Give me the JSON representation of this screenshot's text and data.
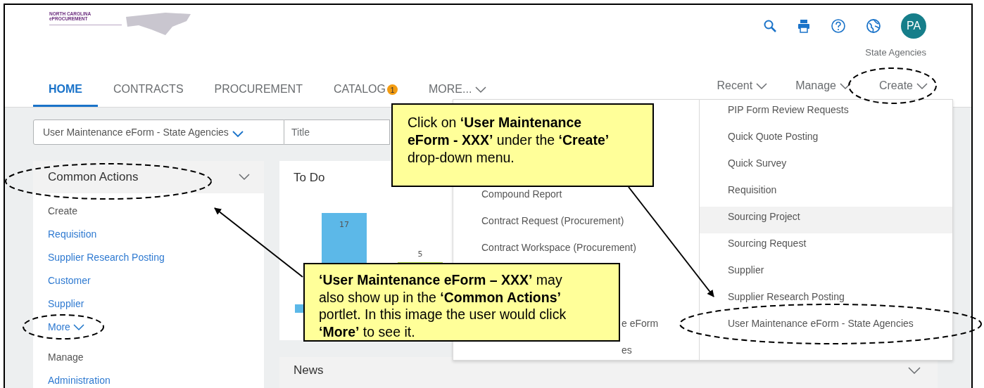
{
  "logo": {
    "lines": [
      "NORTH CAROLINA",
      "ePROCUREMENT"
    ]
  },
  "header": {
    "avatar": "PA",
    "organization": "State Agencies"
  },
  "tabs": [
    {
      "label": "HOME",
      "selected": true
    },
    {
      "label": "CONTRACTS",
      "selected": false
    },
    {
      "label": "PROCUREMENT",
      "selected": false
    },
    {
      "label": "CATALOG",
      "selected": false,
      "badge": "1"
    },
    {
      "label": "MORE...",
      "selected": false,
      "caret": true
    }
  ],
  "nav_menus": [
    {
      "label": "Recent"
    },
    {
      "label": "Manage"
    },
    {
      "label": "Create"
    }
  ],
  "search": {
    "type_value": "User Maintenance eForm - State Agencies",
    "placeholder": "Title"
  },
  "common_actions": {
    "title": "Common Actions",
    "items": [
      {
        "kind": "heading",
        "label": "Create"
      },
      {
        "kind": "link",
        "label": "Requisition"
      },
      {
        "kind": "link",
        "label": "Supplier Research Posting"
      },
      {
        "kind": "link",
        "label": "Customer"
      },
      {
        "kind": "link",
        "label": "Supplier"
      },
      {
        "kind": "more",
        "label": "More"
      },
      {
        "kind": "heading",
        "label": "Manage"
      },
      {
        "kind": "link",
        "label": "Administration"
      }
    ]
  },
  "todo": {
    "title": "To Do",
    "bars": [
      {
        "label": "17",
        "color": "#5cb8e8"
      },
      {
        "label": "5",
        "color": "#a9cf47"
      }
    ]
  },
  "news": {
    "title": "News"
  },
  "create_menu": {
    "left": [
      {
        "label": "Compound Report",
        "kind": "full"
      },
      {
        "label": "Contract Request (Procurement)",
        "kind": "full"
      },
      {
        "label": "Contract Workspace (Procurement)",
        "kind": "full"
      },
      {
        "label": "e eForm",
        "kind": "partial"
      },
      {
        "label": "es",
        "kind": "partial"
      }
    ],
    "right": [
      {
        "label": "PIP Form Review Requests",
        "selected": false
      },
      {
        "label": "Quick Quote Posting",
        "selected": false
      },
      {
        "label": "Quick Survey",
        "selected": false
      },
      {
        "label": "Requisition",
        "selected": false
      },
      {
        "label": "Sourcing Project",
        "selected": true
      },
      {
        "label": "Sourcing Request",
        "selected": false
      },
      {
        "label": "Supplier",
        "selected": false
      },
      {
        "label": "Supplier Research Posting",
        "selected": false
      },
      {
        "label": "User Maintenance eForm - State Agencies",
        "selected": false
      }
    ]
  },
  "callouts": [
    {
      "text": "Click on **‘User Maintenance eForm - XXX’** under the **‘Create’** drop-down menu."
    },
    {
      "text": "**‘User Maintenance eForm – XXX’** may also show up in the **‘Common Actions’** portlet.  In this image the user would click **‘More’** to see it."
    }
  ]
}
